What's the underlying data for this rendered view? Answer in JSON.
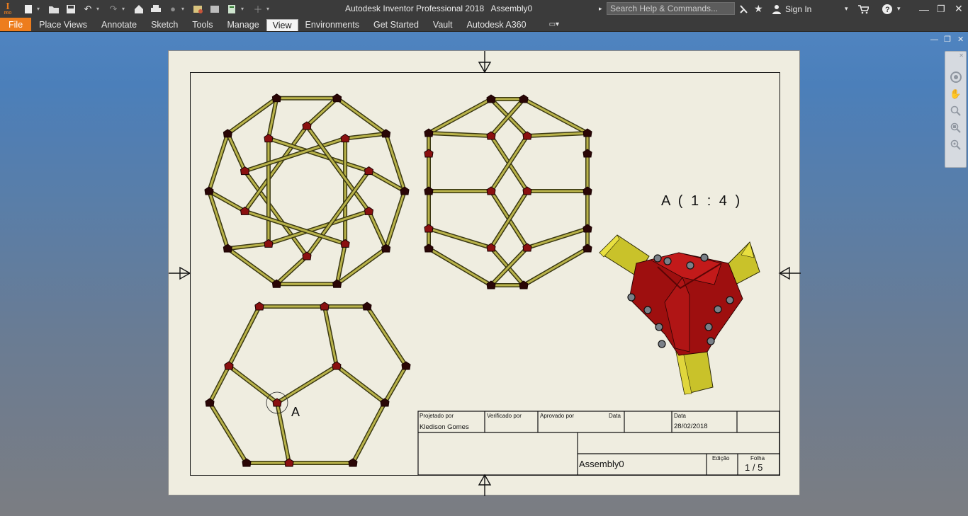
{
  "app": {
    "title": "Autodesk Inventor Professional 2018",
    "document": "Assembly0",
    "search_placeholder": "Search Help & Commands...",
    "sign_in": "Sign In",
    "logo_letter": "I",
    "logo_badge": "PRO"
  },
  "ribbon": {
    "tabs": [
      "File",
      "Place Views",
      "Annotate",
      "Sketch",
      "Tools",
      "Manage",
      "View",
      "Environments",
      "Get Started",
      "Vault",
      "Autodesk A360"
    ],
    "active_tab": "View"
  },
  "drawing": {
    "detail_view_label": "A ( 1 : 4 )",
    "detail_marker": "A",
    "title_block": {
      "projetado_por_label": "Projetado por",
      "projetado_por": "Kledison Gomes",
      "verificado_por_label": "Verificado por",
      "aprovado_por_label": "Aprovado por",
      "data_label_1": "Data",
      "data_label_2": "Data",
      "data": "28/02/2018",
      "title": "Assembly0",
      "edicao_label": "Edição",
      "folha_label": "Folha",
      "folha": "1 / 5"
    }
  },
  "colors": {
    "tube": "#b9b34a",
    "tube_edge": "#3a3812",
    "joint": "#8a1010",
    "sheet": "#efede0",
    "file_tab": "#ed7d1d"
  }
}
